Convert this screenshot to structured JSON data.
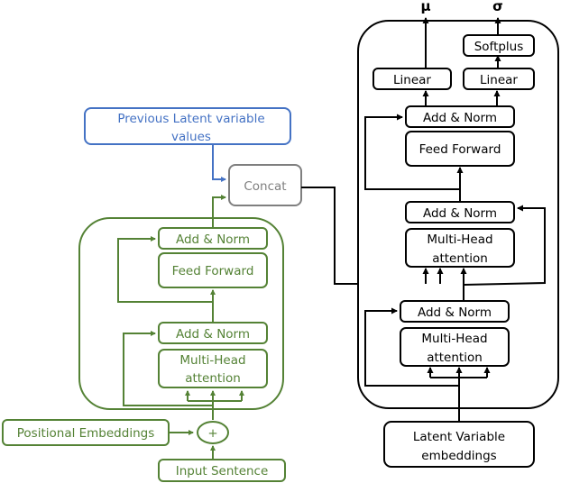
{
  "colors": {
    "encoder": "#548235",
    "decoder": "#000000",
    "previous": "#4472c4",
    "concat": "#7f7f7f"
  },
  "previous_latent": {
    "line1": "Previous Latent variable",
    "line2": "values"
  },
  "concat": {
    "label": "Concat"
  },
  "encoder": {
    "add_norm_top": "Add & Norm",
    "feed_forward": "Feed Forward",
    "add_norm_bottom": "Add & Norm",
    "mha_line1": "Multi-Head",
    "mha_line2": "attention",
    "plus": "+",
    "positional_embeddings": "Positional Embeddings",
    "input_sentence": "Input Sentence"
  },
  "decoder": {
    "outputs": {
      "mu": "μ",
      "sigma": "σ"
    },
    "linear_mu": "Linear",
    "linear_sigma": "Linear",
    "softplus": "Softplus",
    "add_norm_top": "Add & Norm",
    "feed_forward": "Feed Forward",
    "add_norm_mid": "Add & Norm",
    "cross_mha_line1": "Multi-Head",
    "cross_mha_line2": "attention",
    "add_norm_bottom": "Add & Norm",
    "self_mha_line1": "Multi-Head",
    "self_mha_line2": "attention",
    "latent_emb_line1": "Latent Variable",
    "latent_emb_line2": "embeddings"
  }
}
